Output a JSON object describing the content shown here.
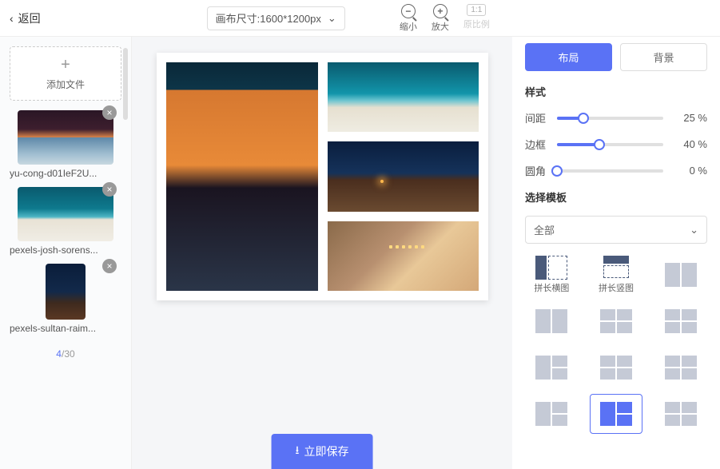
{
  "topbar": {
    "back": "返回",
    "canvas_size_label": "画布尺寸:1600*1200px",
    "zoom_out": "缩小",
    "zoom_in": "放大",
    "ratio": "1:1",
    "ratio_label": "原比例"
  },
  "sidebar": {
    "add_file": "添加文件",
    "items": [
      {
        "label": "yu-cong-d01IeF2U..."
      },
      {
        "label": "pexels-josh-sorens..."
      },
      {
        "label": "pexels-sultan-raim..."
      }
    ],
    "count_current": "4",
    "count_sep": "/",
    "count_total": "30"
  },
  "save_button": "立即保存",
  "panel": {
    "tabs": {
      "layout": "布局",
      "background": "背景"
    },
    "style_title": "样式",
    "sliders": {
      "gap": {
        "label": "间距",
        "value": 25,
        "display": "25  %"
      },
      "border": {
        "label": "边框",
        "value": 40,
        "display": "40  %"
      },
      "radius": {
        "label": "圆角",
        "value": 0,
        "display": "0  %"
      }
    },
    "template_title": "选择模板",
    "template_filter": "全部",
    "template_labels": {
      "horiz": "拼长横图",
      "vert": "拼长竖图"
    }
  }
}
